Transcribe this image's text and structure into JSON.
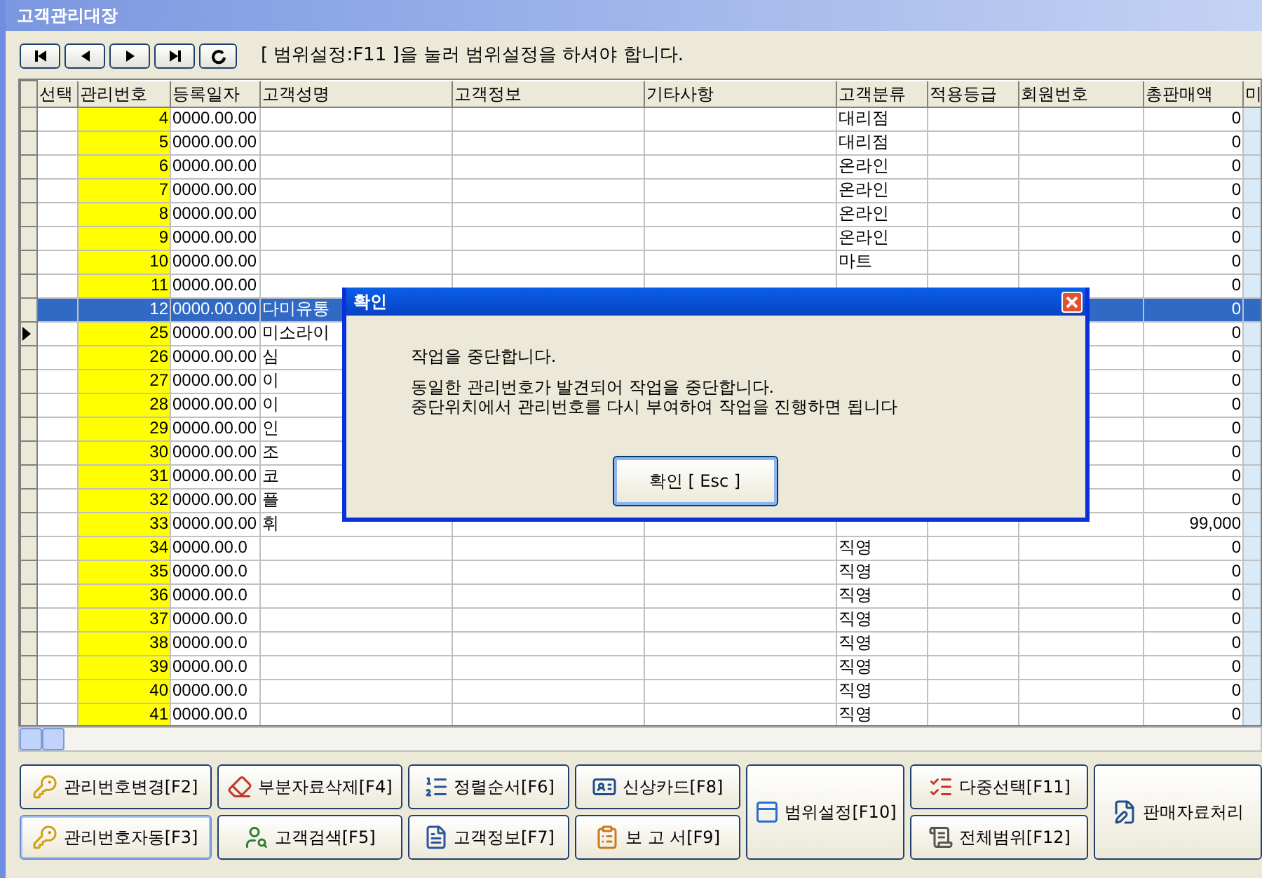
{
  "window": {
    "title": "고객관리대장"
  },
  "navigation": {
    "hint": "[ 범위설정:F11 ]을 눌러 범위설정을 하셔야 합니다."
  },
  "table": {
    "columns": [
      "선택",
      "관리번호",
      "등록일자",
      "고객성명",
      "고객정보",
      "기타사항",
      "고객분류",
      "적용등급",
      "회원번호",
      "총판매액",
      "미"
    ],
    "rows": [
      {
        "number": "4",
        "date": "0000.00.00",
        "category": "대리점",
        "total": "0",
        "selected": false,
        "current": false
      },
      {
        "number": "5",
        "date": "0000.00.00",
        "category": "대리점",
        "total": "0",
        "selected": false,
        "current": false
      },
      {
        "number": "6",
        "date": "0000.00.00",
        "category": "온라인",
        "total": "0",
        "selected": false,
        "current": false
      },
      {
        "number": "7",
        "date": "0000.00.00",
        "category": "온라인",
        "total": "0",
        "selected": false,
        "current": false
      },
      {
        "number": "8",
        "date": "0000.00.00",
        "category": "온라인",
        "total": "0",
        "selected": false,
        "current": false
      },
      {
        "number": "9",
        "date": "0000.00.00",
        "category": "온라인",
        "total": "0",
        "selected": false,
        "current": false
      },
      {
        "number": "10",
        "date": "0000.00.00",
        "category": "마트",
        "total": "0",
        "selected": false,
        "current": false
      },
      {
        "number": "11",
        "date": "0000.00.00",
        "total": "0",
        "selected": false,
        "current": false
      },
      {
        "number": "12",
        "date": "0000.00.00",
        "name": "다미유통",
        "total": "0",
        "selected": true,
        "current": false
      },
      {
        "number": "25",
        "date": "0000.00.00",
        "name": "미소라이",
        "total": "0",
        "selected": false,
        "current": true
      },
      {
        "number": "26",
        "date": "0000.00.00",
        "name": "심",
        "total": "0",
        "selected": false,
        "current": false
      },
      {
        "number": "27",
        "date": "0000.00.00",
        "name": "이",
        "total": "0",
        "selected": false,
        "current": false
      },
      {
        "number": "28",
        "date": "0000.00.00",
        "name": "이",
        "total": "0",
        "selected": false,
        "current": false
      },
      {
        "number": "29",
        "date": "0000.00.00",
        "name": "인",
        "total": "0",
        "selected": false,
        "current": false
      },
      {
        "number": "30",
        "date": "0000.00.00",
        "name": "조",
        "total": "0",
        "selected": false,
        "current": false
      },
      {
        "number": "31",
        "date": "0000.00.00",
        "name": "코",
        "total": "0",
        "selected": false,
        "current": false
      },
      {
        "number": "32",
        "date": "0000.00.00",
        "name": "플",
        "total": "0",
        "selected": false,
        "current": false
      },
      {
        "number": "33",
        "date": "0000.00.00",
        "name": "휘",
        "total": "99,000",
        "selected": false,
        "current": false
      },
      {
        "number": "34",
        "date": "0000.00.0",
        "category": "직영",
        "total": "0",
        "selected": false,
        "current": false
      },
      {
        "number": "35",
        "date": "0000.00.0",
        "category": "직영",
        "total": "0",
        "selected": false,
        "current": false
      },
      {
        "number": "36",
        "date": "0000.00.0",
        "category": "직영",
        "total": "0",
        "selected": false,
        "current": false
      },
      {
        "number": "37",
        "date": "0000.00.0",
        "category": "직영",
        "total": "0",
        "selected": false,
        "current": false
      },
      {
        "number": "38",
        "date": "0000.00.0",
        "category": "직영",
        "total": "0",
        "selected": false,
        "current": false
      },
      {
        "number": "39",
        "date": "0000.00.0",
        "category": "직영",
        "total": "0",
        "selected": false,
        "current": false
      },
      {
        "number": "40",
        "date": "0000.00.0",
        "category": "직영",
        "total": "0",
        "selected": false,
        "current": false
      },
      {
        "number": "41",
        "date": "0000.00.0",
        "category": "직영",
        "total": "0",
        "selected": false,
        "current": false
      }
    ]
  },
  "dialog": {
    "title": "확인",
    "message": "작업을 중단합니다.",
    "details": [
      "동일한 관리번호가 발견되어 작업을 중단합니다.",
      "중단위치에서 관리번호를 다시 부여하여 작업을 진행하면 됩니다"
    ],
    "button": "확인 [ Esc ]"
  },
  "buttons": [
    {
      "label": "관리번호변경[F2]",
      "selected": false
    },
    {
      "label": "관리번호자동[F3]",
      "selected": true
    },
    {
      "label": "부분자료삭제[F4]",
      "selected": false
    },
    {
      "label": "고객검색[F5]",
      "selected": false
    },
    {
      "label": "정렬순서[F6]",
      "selected": false
    },
    {
      "label": "고객정보[F7]",
      "selected": false
    },
    {
      "label": "신상카드[F8]",
      "selected": false
    },
    {
      "label": "보 고 서[F9]",
      "selected": false
    },
    {
      "label": "범위설정[F10]",
      "selected": false
    },
    {
      "label": "다중선택[F11]",
      "selected": false
    },
    {
      "label": "전체범위[F12]",
      "selected": false
    },
    {
      "label": "판매자료처리",
      "selected": false
    }
  ]
}
